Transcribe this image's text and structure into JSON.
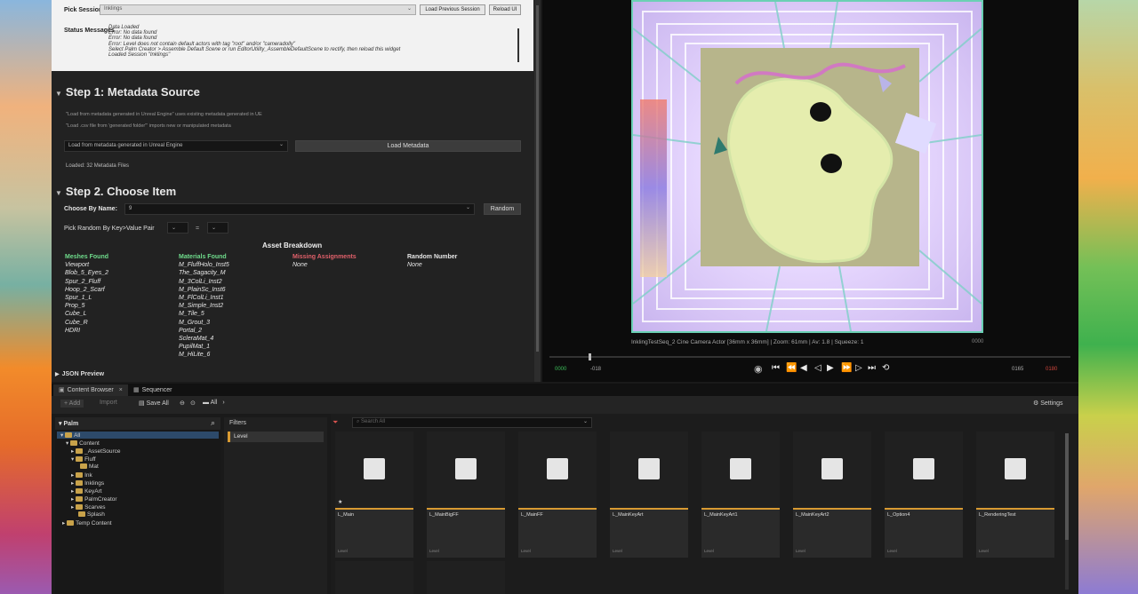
{
  "session": {
    "pick_label": "Pick Session",
    "pick_value": "Inklings",
    "load_previous": "Load Previous Session",
    "reload": "Reload UI",
    "status_label": "Status Messages",
    "status_lines": [
      "Data Loaded",
      "Error: No data found",
      "Error: No data found",
      "Error: Level does not contain default actors with tag \"root\" and/or \"cameradolly\"",
      "Select Palm Creator > Assemble Default Scene or run EditorUtility_AssembleDefaultScene to rectify, then reload this widget",
      "Loaded Session \"Inklings\""
    ]
  },
  "step1": {
    "title": "Step 1: Metadata Source",
    "note1": "\"Load from metadata generated in Unreal Engine\" uses existing metadata generated in UE",
    "note2": "\"Load .csv file from 'generated folder'\" imports new or manipulated metadata",
    "source_value": "Load from metadata generated in Unreal Engine",
    "load_button": "Load Metadata",
    "loaded_text": "Loaded: 32 Metadata Files"
  },
  "step2": {
    "title": "Step 2. Choose Item",
    "choose_label": "Choose By Name:",
    "choose_value": "9",
    "random_button": "Random",
    "pick_random_label": "Pick Random By Key>Value Pair",
    "equals": "=",
    "breakdown_title": "Asset Breakdown",
    "meshes_header": "Meshes Found",
    "meshes": [
      "Viewport",
      "Blob_5_Eyes_2",
      "Spur_2_Fluff",
      "Hoop_2_Scarf",
      "Spur_1_L",
      "Prop_5",
      "Cube_L",
      "Cube_R",
      "HDRI"
    ],
    "materials_header": "Materials Found",
    "materials": [
      "M_FluffHolo_Inst5",
      "The_Sagacity_M",
      "M_3ColLi_Inst2",
      "M_PlainSc_Inst6",
      "M_FlColLi_Inst1",
      "M_Simple_Inst2",
      "M_Tile_5",
      "M_Grout_3",
      "Portal_2",
      "ScleraMat_4",
      "PupilMat_1",
      "M_HiLite_6"
    ],
    "missing_header": "Missing Assignments",
    "missing_value": "None",
    "random_header": "Random Number",
    "random_value": "None",
    "json_preview": "JSON Preview"
  },
  "viewer": {
    "info": "InklingTestSeq_2  Cine Camera Actor  [36mm x 36mm] | Zoom: 61mm | Av: 1.8 | Squeeze: 1",
    "frame_right": "0000",
    "tc_start": "0000",
    "tc_start2": "-018",
    "tc_end": "0165",
    "tc_end2": "0180"
  },
  "tabs": {
    "content_browser": "Content Browser",
    "sequencer": "Sequencer"
  },
  "toolbar": {
    "add": "+ Add",
    "import": "Import",
    "save_all": "Save All",
    "all": "All",
    "settings": "Settings"
  },
  "tree": {
    "root": "Palm",
    "items": [
      "All",
      "Content",
      "_AssetSource",
      "Fluff",
      "Mat",
      "Ink",
      "Inklings",
      "KeyArt",
      "PalmCreator",
      "Scarves",
      "Splash",
      "Temp Content"
    ]
  },
  "filters": {
    "title": "Filters",
    "level": "Level"
  },
  "search": {
    "placeholder": "Search All"
  },
  "assets": [
    {
      "name": "L_Main",
      "type": "Level"
    },
    {
      "name": "L_MainBigFF",
      "type": "Level"
    },
    {
      "name": "L_MainFF",
      "type": "Level"
    },
    {
      "name": "L_MainKeyArt",
      "type": "Level"
    },
    {
      "name": "L_MainKeyArt1",
      "type": "Level"
    },
    {
      "name": "L_MainKeyArt2",
      "type": "Level"
    },
    {
      "name": "L_Option4",
      "type": "Level"
    },
    {
      "name": "L_RenderingTest",
      "type": "Level"
    }
  ],
  "colors": {
    "accent_orange": "#d89a32",
    "green_header": "#6fdc8c",
    "red_header": "#e0606a",
    "frame_border": "#6bd0b4"
  }
}
